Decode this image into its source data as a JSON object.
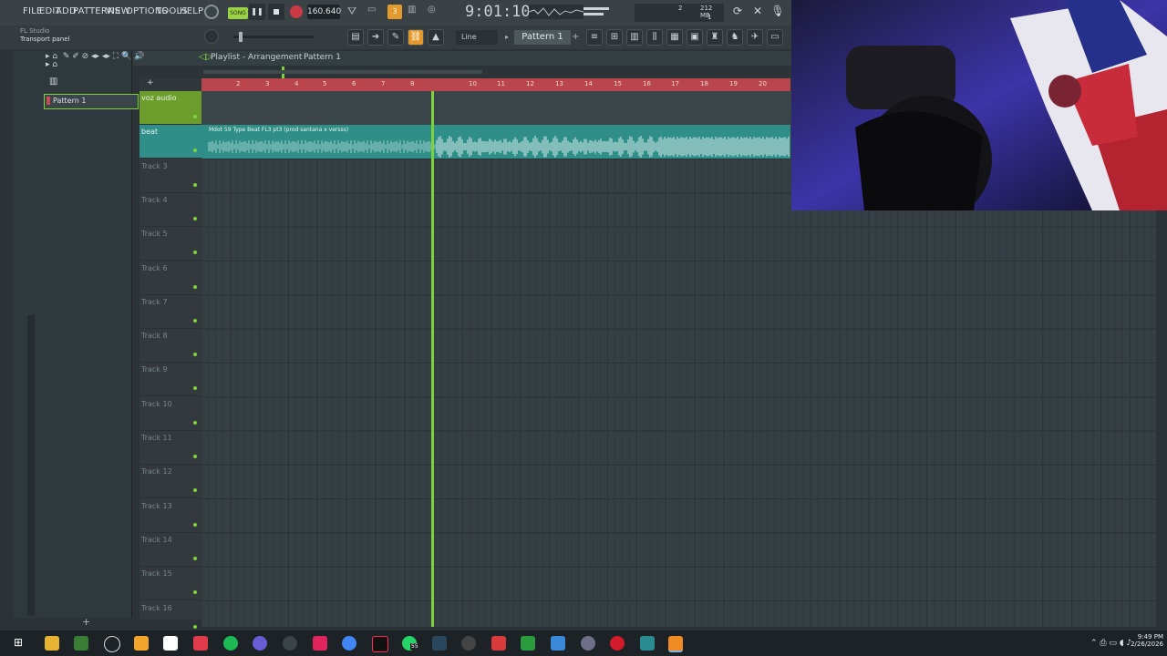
{
  "menubar": {
    "items": [
      "FILE",
      "EDIT",
      "ADD",
      "PATTERNS",
      "VIEW",
      "OPTIONS",
      "TOOLS",
      "HELP"
    ],
    "song_toggle": "SONG",
    "tempo": "160.640",
    "time": "9:01:10",
    "memory": "212 MB",
    "cpu_value": "2",
    "poly_value": "1"
  },
  "hint_bar": {
    "app": "FL Studio",
    "hint": "Transport panel"
  },
  "toolbar": {
    "snap": "Line",
    "pattern": "Pattern 1"
  },
  "playlist": {
    "breadcrumb_title": "Playlist - Arrangement",
    "breadcrumb_pattern": "Pattern 1",
    "pattern_list": [
      "Pattern 1"
    ],
    "ruler": [
      "2",
      "3",
      "4",
      "5",
      "6",
      "7",
      "8",
      "10",
      "11",
      "12",
      "13",
      "14",
      "15",
      "16",
      "17",
      "18",
      "19",
      "20"
    ],
    "tracks": [
      "voz audio",
      "beat",
      "Track 3",
      "Track 4",
      "Track 5",
      "Track 6",
      "Track 7",
      "Track 8",
      "Track 9",
      "Track 10",
      "Track 11",
      "Track 12",
      "Track 13",
      "Track 14",
      "Track 15",
      "Track 16"
    ],
    "clip_title": "Mdot 59 Type Beat FL3 pt3 (prod santana x versss)",
    "playhead_fraction": 0.39
  },
  "taskbar": {
    "time": "9:49 PM",
    "date": "2/26/2026",
    "badge": "55"
  },
  "colors": {
    "accent_green": "#7dd13a",
    "ruler_red": "#b9464d",
    "clip_teal": "#2f8f88",
    "voz_green": "#6d9e2d"
  }
}
